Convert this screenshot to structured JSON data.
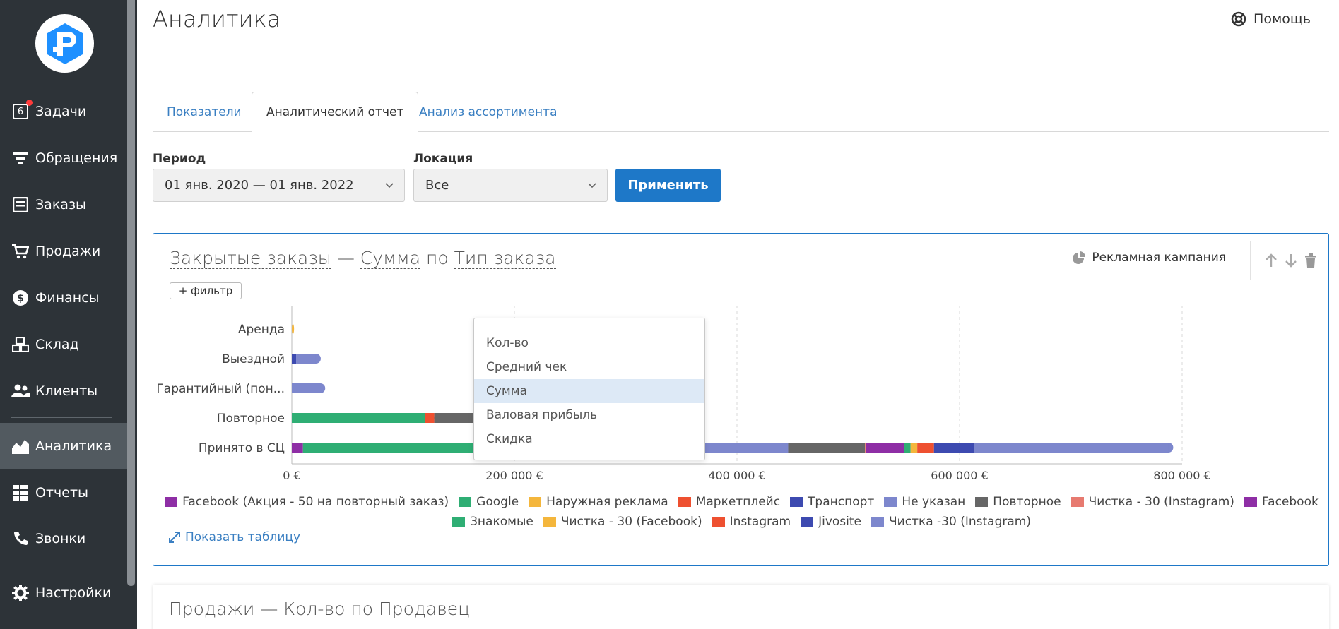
{
  "app": {
    "page_title": "Аналитика",
    "help_label": "Помощь"
  },
  "sidebar": {
    "items": [
      {
        "label": "Задачи",
        "icon": "tasks-icon",
        "badge": "6"
      },
      {
        "label": "Обращения",
        "icon": "filter-icon"
      },
      {
        "label": "Заказы",
        "icon": "orders-icon"
      },
      {
        "label": "Продажи",
        "icon": "cart-icon"
      },
      {
        "label": "Финансы",
        "icon": "dollar-icon"
      },
      {
        "label": "Склад",
        "icon": "boxes-icon"
      },
      {
        "label": "Клиенты",
        "icon": "users-icon"
      },
      {
        "label": "Аналитика",
        "icon": "chart-area-icon",
        "active": true
      },
      {
        "label": "Отчеты",
        "icon": "grid-icon"
      },
      {
        "label": "Звонки",
        "icon": "phone-icon"
      },
      {
        "label": "Настройки",
        "icon": "gear-icon"
      }
    ]
  },
  "tabs": [
    {
      "label": "Показатели"
    },
    {
      "label": "Аналитический отчет",
      "active": true
    },
    {
      "label": "Анализ ассортимента"
    }
  ],
  "filters": {
    "period_label": "Период",
    "period_value": "01 янв. 2020 — 01 янв. 2022",
    "location_label": "Локация",
    "location_value": "Все",
    "apply_label": "Применить"
  },
  "report": {
    "title_part1": "Закрытые заказы",
    "dash": "—",
    "metric": "Сумма",
    "by": "по",
    "group": "Тип заказа",
    "campaign_label": "Рекламная кампания",
    "filter_button": "+ фильтр",
    "show_table": "Показать таблицу",
    "metric_options": [
      "Кол-во",
      "Средний чек",
      "Сумма",
      "Валовая прибыль",
      "Скидка"
    ],
    "selected_metric": "Сумма"
  },
  "chart_data": {
    "type": "bar",
    "orientation": "horizontal",
    "stacked": true,
    "categories": [
      "Аренда",
      "Выездной",
      "Гарантийный (пон...",
      "Повторное",
      "Принято в СЦ"
    ],
    "xlim": [
      0,
      800000
    ],
    "x_ticks": [
      "0 €",
      "200 000 €",
      "400 000 €",
      "600 000 €",
      "800 000 €"
    ],
    "grid": true,
    "legend_position": "bottom",
    "series": [
      {
        "name": "Facebook (Акция - 50 на повторный заказ)",
        "color": "#8e2ea5",
        "values": [
          0,
          0,
          0,
          0,
          10000
        ]
      },
      {
        "name": "Google",
        "color": "#2fae74",
        "values": [
          0,
          0,
          0,
          120000,
          183000
        ]
      },
      {
        "name": "Наружная реклама",
        "color": "#f4b63c",
        "values": [
          2000,
          0,
          0,
          0,
          42000
        ]
      },
      {
        "name": "Маркетплейс",
        "color": "#ee5030",
        "values": [
          0,
          0,
          0,
          8000,
          23000
        ]
      },
      {
        "name": "Транспорт",
        "color": "#3d4ab0",
        "values": [
          0,
          4000,
          0,
          0,
          17000
        ]
      },
      {
        "name": "Не указан",
        "color": "#7d87cd",
        "values": [
          0,
          22000,
          30000,
          0,
          171000
        ]
      },
      {
        "name": "Повторное",
        "color": "#666666",
        "values": [
          0,
          0,
          0,
          66000,
          69000
        ]
      },
      {
        "name": "Чистка - 30 (Instagram)",
        "color": "#e77a70",
        "values": [
          0,
          0,
          0,
          0,
          1000
        ]
      },
      {
        "name": "Facebook",
        "color": "#8e2ea5",
        "values": [
          0,
          0,
          0,
          0,
          34000
        ]
      },
      {
        "name": "Знакомые",
        "color": "#2fae74",
        "values": [
          0,
          0,
          0,
          0,
          6000
        ]
      },
      {
        "name": "Чистка - 30 (Facebook)",
        "color": "#f4b63c",
        "values": [
          0,
          0,
          0,
          0,
          6000
        ]
      },
      {
        "name": "Instagram",
        "color": "#ee5030",
        "values": [
          0,
          0,
          0,
          0,
          15000
        ]
      },
      {
        "name": "Jivosite",
        "color": "#3d4ab0",
        "values": [
          0,
          0,
          0,
          0,
          36000
        ]
      },
      {
        "name": "Чистка -30 (Instagram)",
        "color": "#7d87cd",
        "values": [
          0,
          0,
          0,
          0,
          179000
        ]
      }
    ]
  },
  "report2": {
    "title_part1": "Продажи",
    "dash": "—",
    "metric": "Кол-во",
    "by": "по",
    "group": "Продавец"
  }
}
